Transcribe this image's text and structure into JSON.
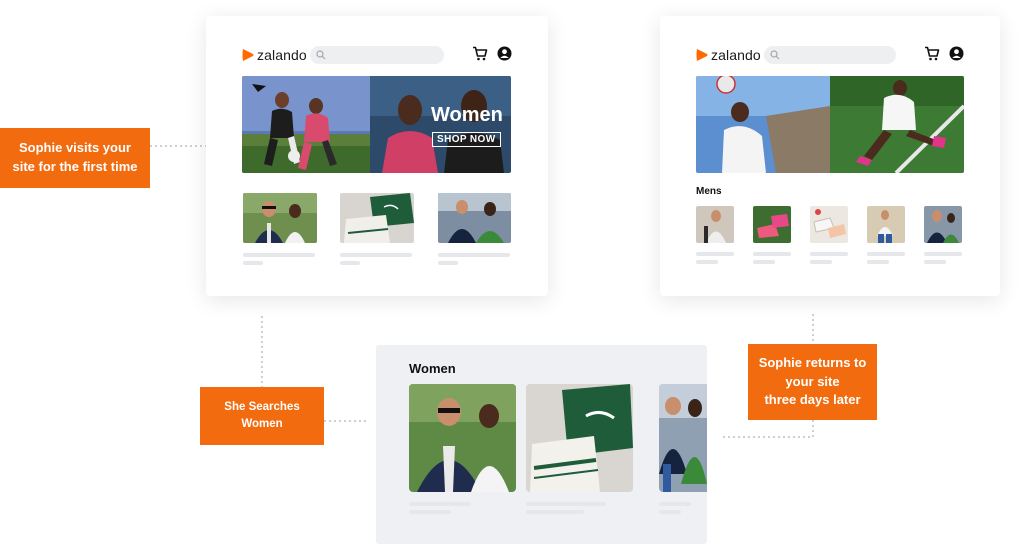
{
  "brand": {
    "name": "zalando",
    "color": "#ff6900"
  },
  "colors": {
    "accent": "#f26b0f",
    "placeholder": "#e6e7ea",
    "panel": "#eef0f4"
  },
  "screen_first": {
    "hero": {
      "title": "Women",
      "button": "SHOP NOW"
    },
    "icons": [
      "search-icon",
      "cart-icon",
      "account-icon"
    ]
  },
  "screen_return": {
    "section_title": "Mens",
    "icons": [
      "search-icon",
      "cart-icon",
      "account-icon"
    ]
  },
  "search_results": {
    "title": "Women"
  },
  "callouts": [
    {
      "text": "Sophie visits your\nsite for the first time"
    },
    {
      "text": "She Searches\nWomen"
    },
    {
      "text": "Sophie returns to\nyour site\nthree days later"
    }
  ]
}
